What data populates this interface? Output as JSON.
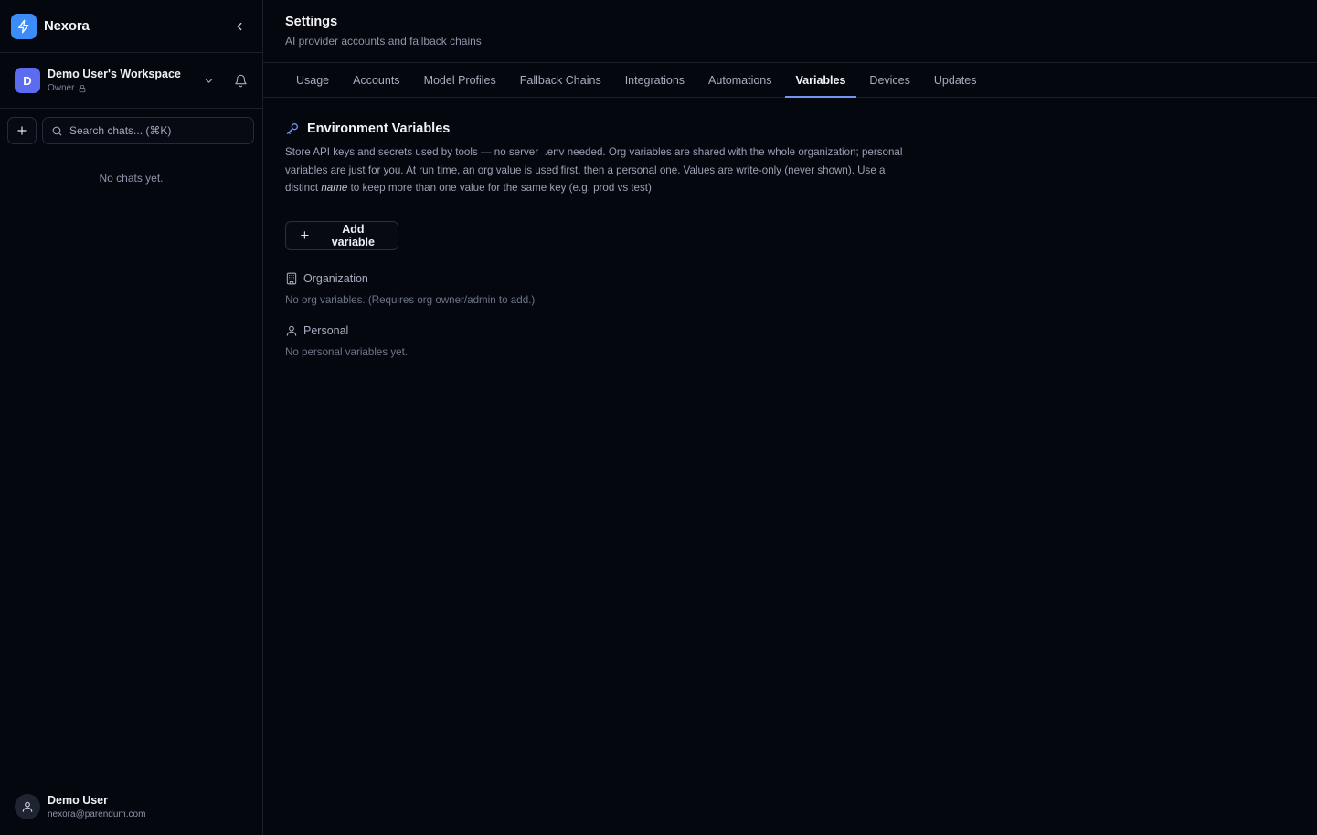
{
  "brand": {
    "name": "Nexora"
  },
  "workspace": {
    "initial": "D",
    "name": "Demo User's Workspace",
    "role": "Owner"
  },
  "search": {
    "placeholder": "Search chats... (⌘K)"
  },
  "chats": {
    "empty_text": "No chats yet."
  },
  "user": {
    "name": "Demo User",
    "email": "nexora@parendum.com"
  },
  "header": {
    "title": "Settings",
    "subtitle": "AI provider accounts and fallback chains"
  },
  "tabs": [
    {
      "label": "Usage",
      "active": false
    },
    {
      "label": "Accounts",
      "active": false
    },
    {
      "label": "Model Profiles",
      "active": false
    },
    {
      "label": "Fallback Chains",
      "active": false
    },
    {
      "label": "Integrations",
      "active": false
    },
    {
      "label": "Automations",
      "active": false
    },
    {
      "label": "Variables",
      "active": true
    },
    {
      "label": "Devices",
      "active": false
    },
    {
      "label": "Updates",
      "active": false
    }
  ],
  "env": {
    "title": "Environment Variables",
    "desc_part1": "Store API keys and secrets used by tools — no server",
    "desc_code": ".env",
    "desc_part2": "needed. Org variables are shared with the whole organization; personal variables are just for you. At run time, an org value is used first, then a personal one. Values are write-only (never shown). Use a distinct",
    "desc_em": "name",
    "desc_part3": "to keep more than one value for the same key (e.g. prod vs test).",
    "add_label": "Add variable"
  },
  "groups": {
    "organization": {
      "title": "Organization",
      "empty": "No org variables. (Requires org owner/admin to add.)"
    },
    "personal": {
      "title": "Personal",
      "empty": "No personal variables yet."
    }
  },
  "colors": {
    "accent": "#6f95f5",
    "brand": "#3b8cf6",
    "workspace_avatar": "#5b6cf0",
    "background": "#05070f"
  }
}
